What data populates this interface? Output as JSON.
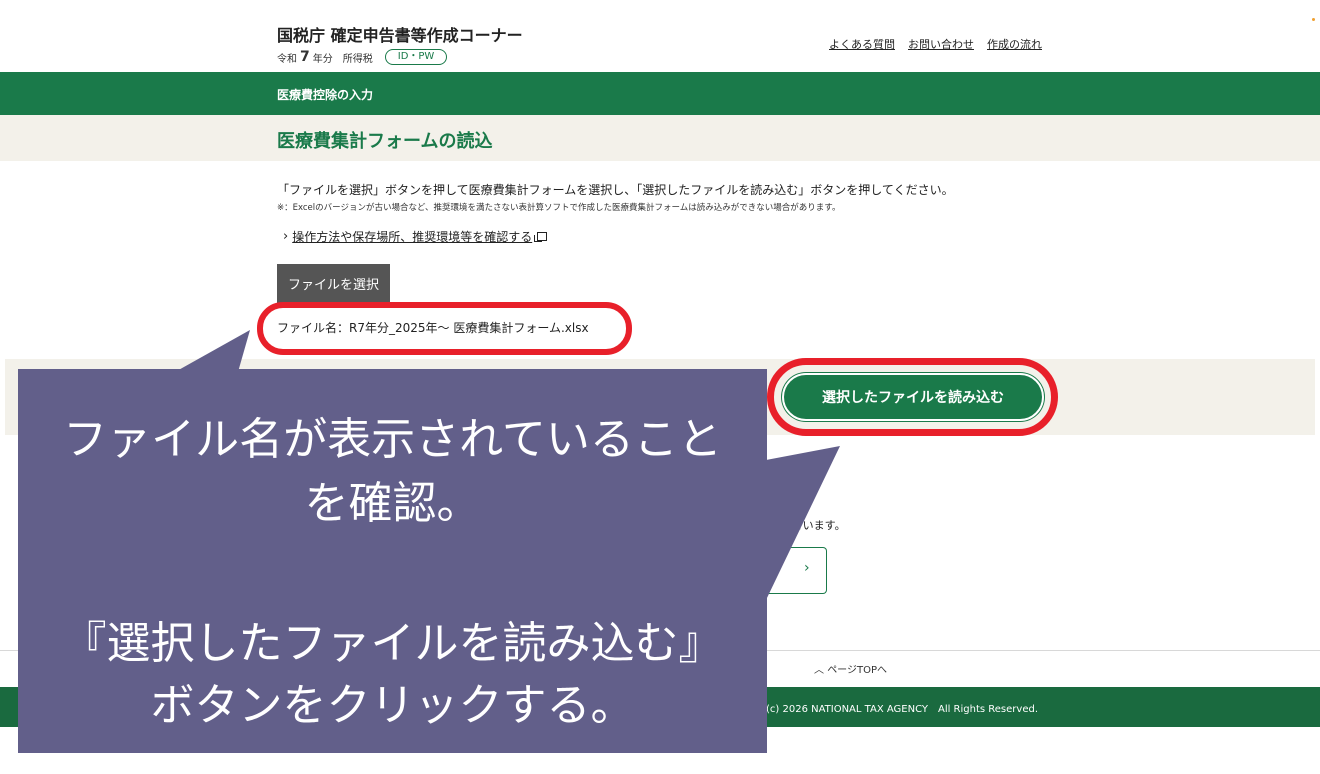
{
  "header": {
    "app_title": "国税庁 確定申告書等作成コーナー",
    "era": "令和",
    "year": "7",
    "year_suffix": "年分",
    "tax_type": "所得税",
    "auth_badge": "ID・PW",
    "links": [
      "よくある質問",
      "お問い合わせ",
      "作成の流れ"
    ]
  },
  "nav": {
    "section_label": "医療費控除の入力"
  },
  "main": {
    "page_title": "医療費集計フォームの読込",
    "instruction": "「ファイルを選択」ボタンを押して医療費集計フォームを選択し、「選択したファイルを読み込む」ボタンを押してください。",
    "note": "※：Excelのバージョンが古い場合など、推奨環境を満たさない表計算ソフトで作成した医療費集計フォームは読み込みができない場合があります。",
    "help_link": "操作方法や保存場所、推奨環境等を確認する",
    "file_select_button": "ファイルを選択",
    "file_name": "ファイル名：R7年分_2025年〜 医療費集計フォーム.xlsx",
    "load_button": "選択したファイルを読み込む",
    "partial_text": "載しています。",
    "next_chevron": "›"
  },
  "footer": {
    "page_top": "ページTOPへ",
    "copyright": "(c) 2026 NATIONAL TAX AGENCY　All Rights Reserved."
  },
  "callout": {
    "line1": "ファイル名が表示されていること",
    "line2": "を確認。",
    "line3": "『選択したファイルを読み込む』",
    "line4": "ボタンをクリックする。"
  },
  "colors": {
    "primary_green": "#1a7a4a",
    "highlight_red": "#e8202a",
    "callout_bg": "#625f8a",
    "band_bg": "#f3f1ea"
  }
}
